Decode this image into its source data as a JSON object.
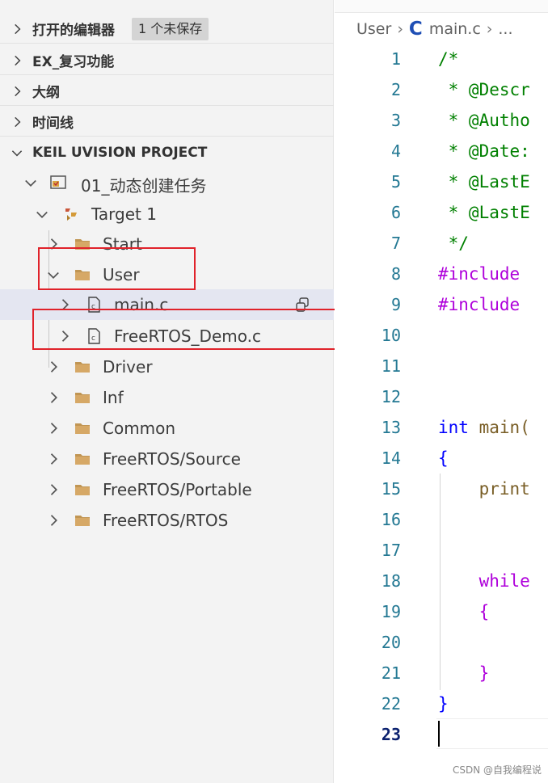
{
  "sidebar": {
    "sections": [
      {
        "title": "打开的编辑器",
        "badge": "1 个未保存"
      },
      {
        "title": "EX_复习功能"
      },
      {
        "title": "大纲"
      },
      {
        "title": "时间线"
      },
      {
        "title": "KEIL UVISION PROJECT"
      }
    ],
    "tree": {
      "project": "01_动态创建任务",
      "target": "Target 1",
      "groups": [
        {
          "label": "Start"
        },
        {
          "label": "User"
        },
        {
          "label": "main.c"
        },
        {
          "label": "FreeRTOS_Demo.c"
        },
        {
          "label": "Driver"
        },
        {
          "label": "Inf"
        },
        {
          "label": "Common"
        },
        {
          "label": "FreeRTOS/Source"
        },
        {
          "label": "FreeRTOS/Portable"
        },
        {
          "label": "FreeRTOS/RTOS"
        }
      ]
    }
  },
  "editor": {
    "breadcrumb": {
      "folder": "User",
      "lang_glyph": "C",
      "file": "main.c",
      "more": "..."
    },
    "lines": [
      "/*",
      " * @Descr",
      " * @Autho",
      " * @Date:",
      " * @LastE",
      " * @LastE",
      " */",
      "#include",
      "#include",
      "",
      "",
      "",
      "int main(",
      "{",
      "    print",
      "",
      "",
      "    while",
      "    {",
      "",
      "    }",
      "}",
      ""
    ],
    "line_numbers": [
      "1",
      "2",
      "3",
      "4",
      "5",
      "6",
      "7",
      "8",
      "9",
      "10",
      "11",
      "12",
      "13",
      "14",
      "15",
      "16",
      "17",
      "18",
      "19",
      "20",
      "21",
      "22",
      "23"
    ],
    "active_line": "23"
  },
  "colors": {
    "highlight_box": "#e0222a",
    "comment": "#008000",
    "keyword": "#0000ff",
    "macro": "#af00db",
    "folder": "#c09553"
  },
  "watermark": "CSDN @自我编程说"
}
